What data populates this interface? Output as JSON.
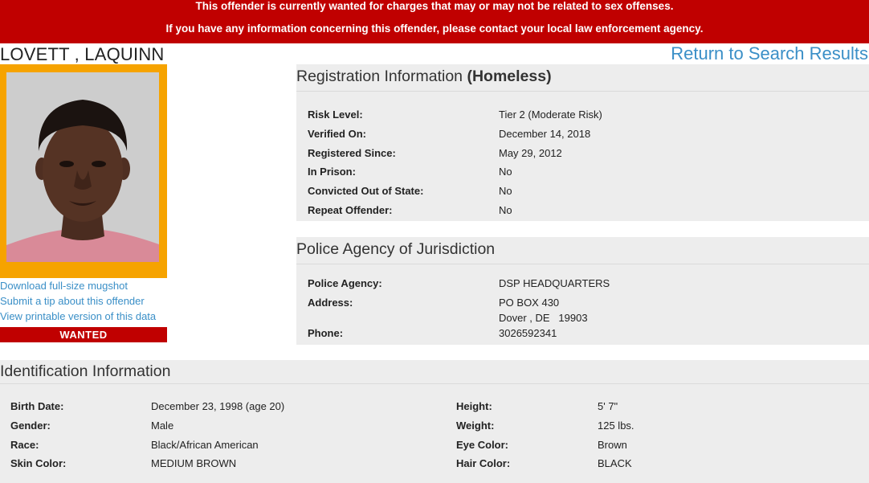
{
  "banner": {
    "line1": "This offender is currently wanted for charges that may or may not be related to sex offenses.",
    "line2": "If you have any information concerning this offender, please contact your local law enforcement agency."
  },
  "offender_name": "LOVETT , LAQUINN",
  "return_link": "Return to Search Results",
  "photo": {
    "status_label": "WANTED"
  },
  "side_links": [
    "Download full-size mugshot",
    "Submit a tip about this offender",
    "View printable version of this data"
  ],
  "registration": {
    "title": "Registration Information",
    "title_suffix": "(Homeless)",
    "rows": [
      {
        "label": "Risk Level:",
        "value": "Tier 2 (Moderate Risk)"
      },
      {
        "label": "Verified On:",
        "value": "December 14, 2018"
      },
      {
        "label": "Registered Since:",
        "value": "May 29, 2012"
      },
      {
        "label": "In Prison:",
        "value": "No"
      },
      {
        "label": "Convicted Out of State:",
        "value": "No"
      },
      {
        "label": "Repeat Offender:",
        "value": "No"
      }
    ]
  },
  "police": {
    "title": "Police Agency of Jurisdiction",
    "agency_label": "Police Agency:",
    "agency_value": "DSP HEADQUARTERS",
    "address_label": "Address:",
    "address_line1": "PO BOX 430",
    "address_line2": "Dover , DE   19903",
    "phone_label": "Phone:",
    "phone_value": "3026592341"
  },
  "identification": {
    "title": "Identification Information",
    "left_rows": [
      {
        "label": "Birth Date:",
        "value": "December 23, 1998 (age 20)"
      },
      {
        "label": "Gender:",
        "value": "Male"
      },
      {
        "label": "Race:",
        "value": "Black/African American"
      },
      {
        "label": "Skin Color:",
        "value": "MEDIUM BROWN"
      }
    ],
    "right_rows": [
      {
        "label": "Height:",
        "value": "5' 7\""
      },
      {
        "label": "Weight:",
        "value": "125 lbs."
      },
      {
        "label": "Eye Color:",
        "value": "Brown"
      },
      {
        "label": "Hair Color:",
        "value": "BLACK"
      }
    ]
  },
  "colors": {
    "banner_red": "#c00000",
    "photo_frame_orange": "#f6a300",
    "link_blue": "#3a8fc7",
    "panel_grey": "#ededed"
  }
}
